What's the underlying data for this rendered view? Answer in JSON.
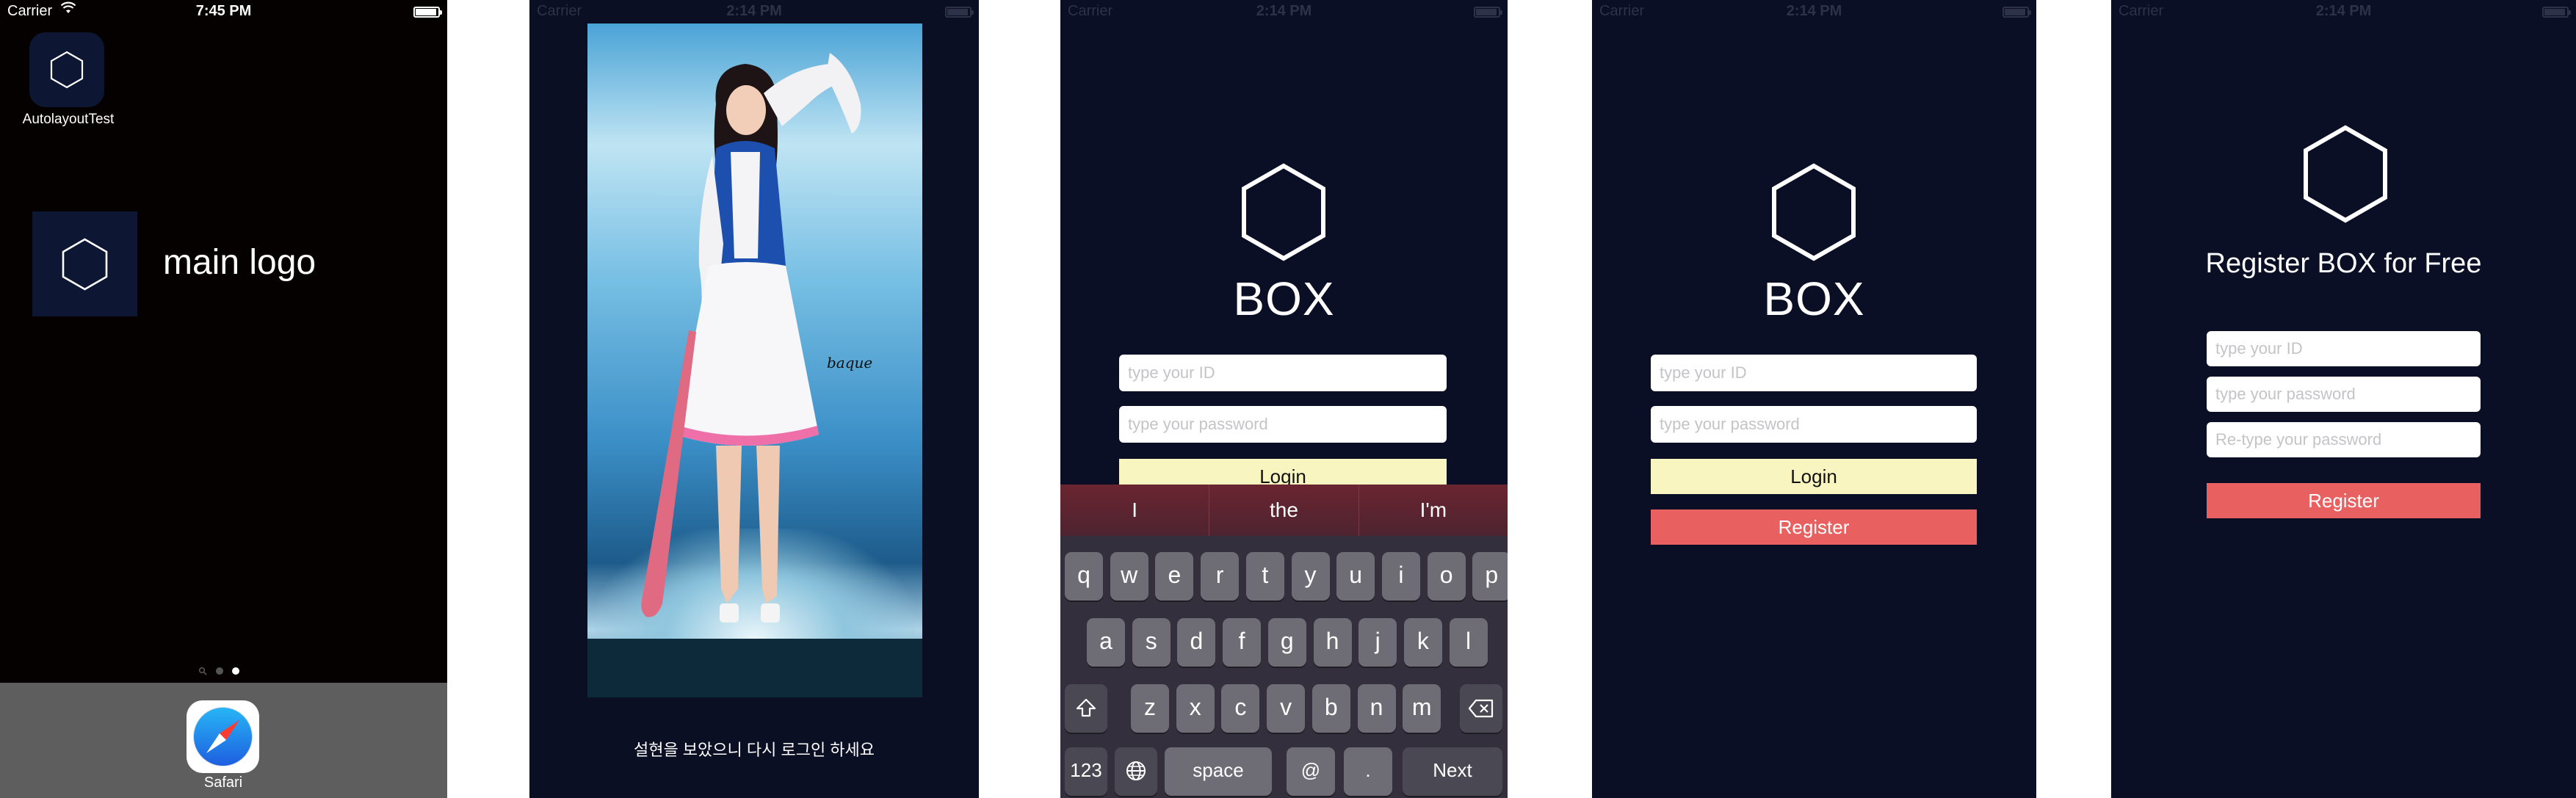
{
  "colors": {
    "app_background": "#0b0f26",
    "login_button": "#f8f5c0",
    "register_button": "#e8605f",
    "home_background": "#050101",
    "dock": "#5e5e5e"
  },
  "home_screen": {
    "status": {
      "carrier": "Carrier",
      "time": "7:45 PM"
    },
    "app_icon_label": "AutolayoutTest",
    "logo_label": "main logo",
    "dock_app_label": "Safari"
  },
  "photo_screen": {
    "status": {
      "carrier": "Carrier",
      "time": "2:14 PM"
    },
    "watermark": "baque",
    "caption": "설현을 보았으니 다시 로그인 하세요"
  },
  "login_screen": {
    "status": {
      "carrier": "Carrier",
      "time": "2:14 PM"
    },
    "brand": "BOX",
    "id_placeholder": "type your ID",
    "password_placeholder": "type your password",
    "login_label": "Login"
  },
  "keyboard": {
    "suggestions": [
      "I",
      "the",
      "I'm"
    ],
    "row1": [
      "q",
      "w",
      "e",
      "r",
      "t",
      "y",
      "u",
      "i",
      "o",
      "p"
    ],
    "row2": [
      "a",
      "s",
      "d",
      "f",
      "g",
      "h",
      "j",
      "k",
      "l"
    ],
    "row3": [
      "z",
      "x",
      "c",
      "v",
      "b",
      "n",
      "m"
    ],
    "numbers_key": "123",
    "space_key": "space",
    "at_key": "@",
    "period_key": ".",
    "next_key": "Next"
  },
  "login_register_screen": {
    "status": {
      "carrier": "Carrier",
      "time": "2:14 PM"
    },
    "brand": "BOX",
    "id_placeholder": "type your ID",
    "password_placeholder": "type your password",
    "login_label": "Login",
    "register_label": "Register"
  },
  "register_screen": {
    "status": {
      "carrier": "Carrier",
      "time": "2:14 PM"
    },
    "title": "Register BOX for Free",
    "id_placeholder": "type your ID",
    "password_placeholder": "type your password",
    "retype_placeholder": "Re-type your password",
    "register_label": "Register"
  }
}
